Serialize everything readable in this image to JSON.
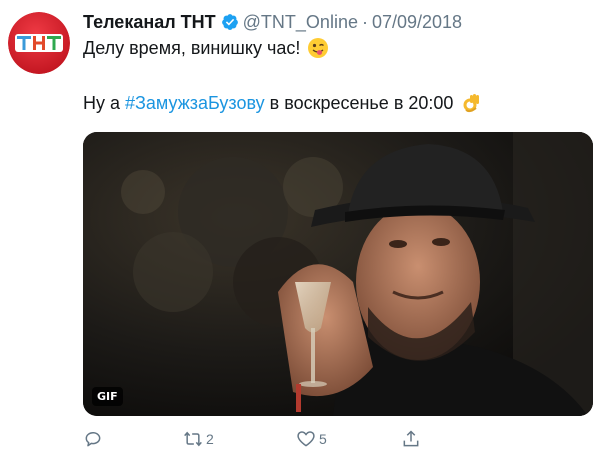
{
  "author": {
    "display_name": "Телеканал ТНТ",
    "handle": "@TNT_Online",
    "separator": "·",
    "date": "07/09/2018",
    "verified": true,
    "avatar_logo_text": "ТНТ",
    "avatar_color": "#d61f2c"
  },
  "tweet": {
    "line1_text": "Делу время, винишку час!",
    "line1_emoji": "winking-face-with-tongue-emoji",
    "line2_prefix": "Ну а",
    "line2_hashtag": "#ЗамужзаБузову",
    "line2_suffix": "в воскресенье в 20:00",
    "line2_emoji": "ok-hand-emoji",
    "hashtag_color": "#1b95e0"
  },
  "media": {
    "type": "gif",
    "badge": "GIF",
    "icon": "gif-media"
  },
  "actions": {
    "reply": {
      "icon": "reply-icon",
      "count": ""
    },
    "retweet": {
      "icon": "retweet-icon",
      "count": "2"
    },
    "like": {
      "icon": "heart-icon",
      "count": "5"
    },
    "share": {
      "icon": "share-icon",
      "count": ""
    }
  }
}
